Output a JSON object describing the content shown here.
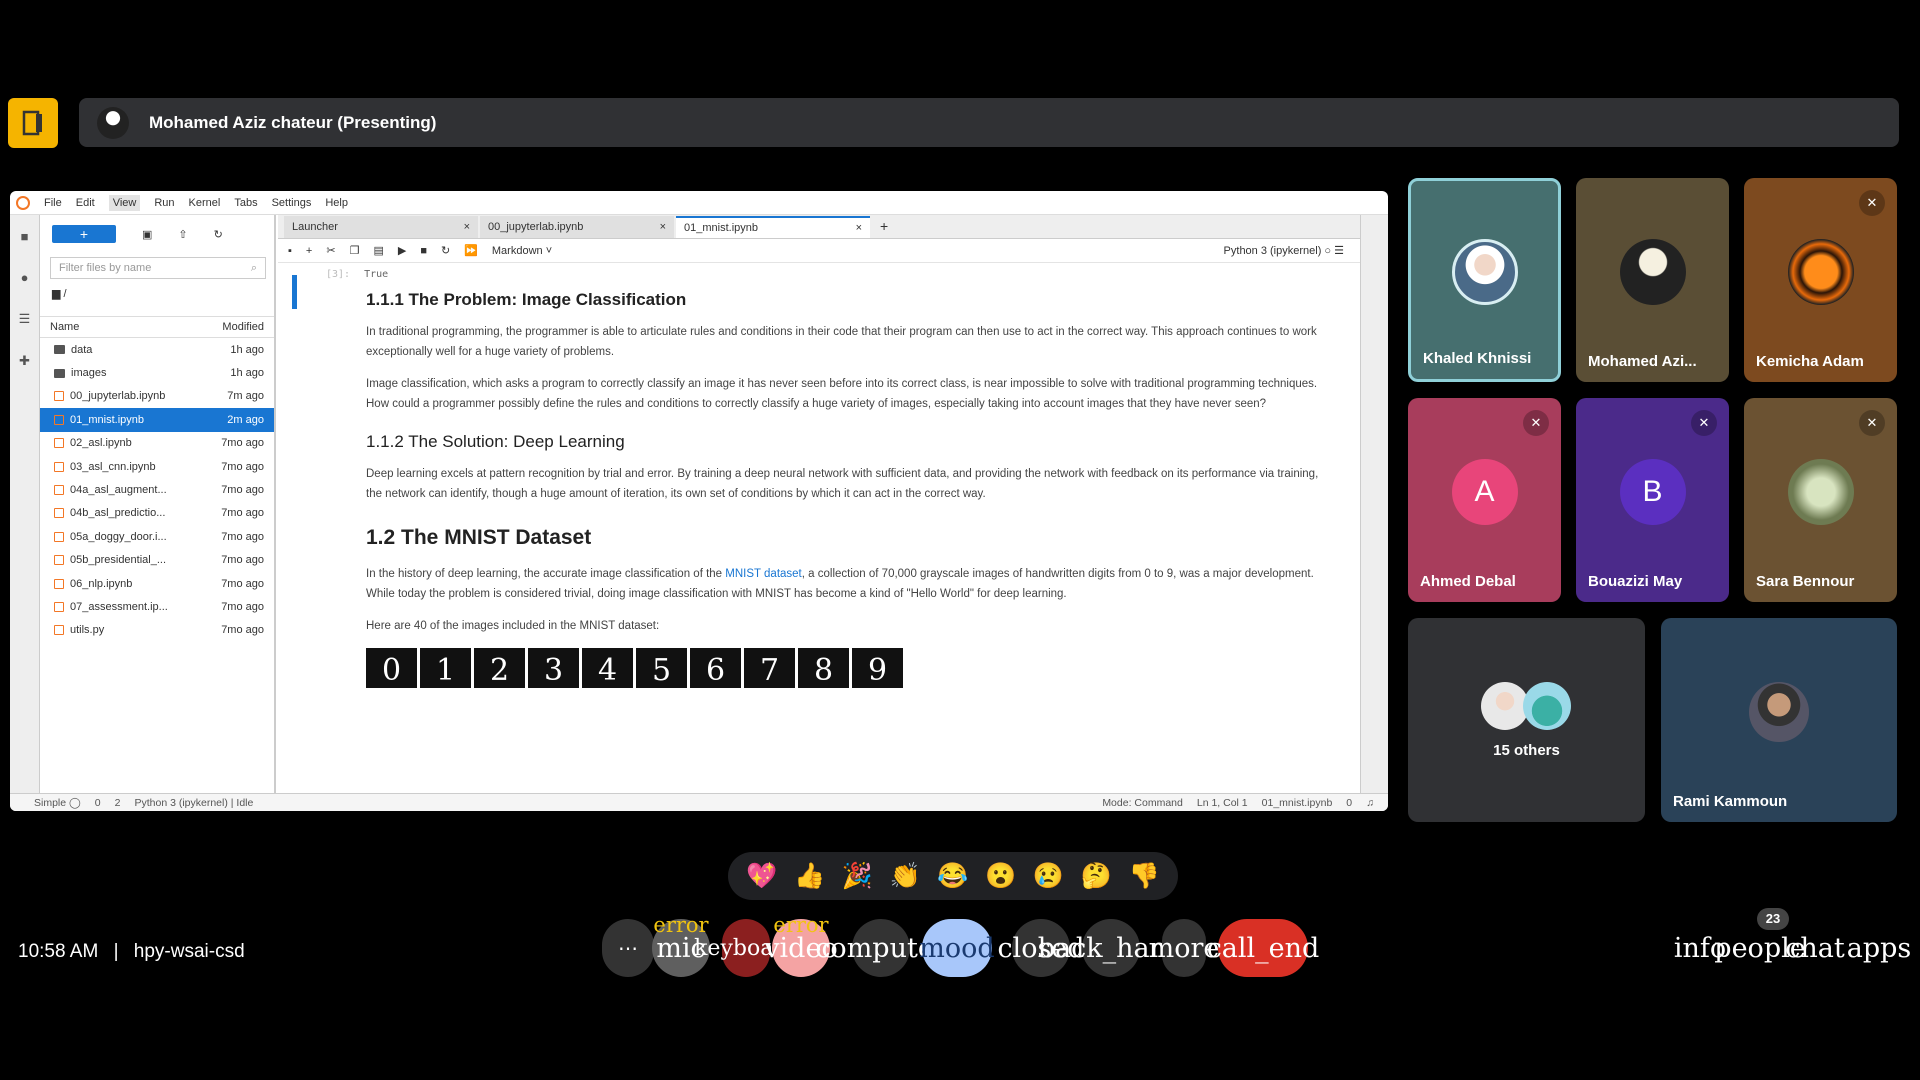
{
  "presenter": {
    "label": "Mohamed Aziz chateur (Presenting)"
  },
  "jupyter": {
    "menu": [
      "File",
      "Edit",
      "View",
      "Run",
      "Kernel",
      "Tabs",
      "Settings",
      "Help"
    ],
    "filter_placeholder": "Filter files by name",
    "crumb": "/",
    "col_name": "Name",
    "col_modified": "Modified",
    "files": [
      {
        "name": "data",
        "mod": "1h ago"
      },
      {
        "name": "images",
        "mod": "1h ago"
      },
      {
        "name": "00_jupyterlab.ipynb",
        "mod": "7m ago"
      },
      {
        "name": "01_mnist.ipynb",
        "mod": "2m ago"
      },
      {
        "name": "02_asl.ipynb",
        "mod": "7mo ago"
      },
      {
        "name": "03_asl_cnn.ipynb",
        "mod": "7mo ago"
      },
      {
        "name": "04a_asl_augment...",
        "mod": "7mo ago"
      },
      {
        "name": "04b_asl_predictio...",
        "mod": "7mo ago"
      },
      {
        "name": "05a_doggy_door.i...",
        "mod": "7mo ago"
      },
      {
        "name": "05b_presidential_...",
        "mod": "7mo ago"
      },
      {
        "name": "06_nlp.ipynb",
        "mod": "7mo ago"
      },
      {
        "name": "07_assessment.ip...",
        "mod": "7mo ago"
      },
      {
        "name": "utils.py",
        "mod": "7mo ago"
      }
    ],
    "tabs": [
      "Launcher",
      "00_jupyterlab.ipynb",
      "01_mnist.ipynb"
    ],
    "celltype": "Markdown",
    "kernel": "Python 3 (ipykernel)",
    "out_label": "[3]:",
    "out_text": "True",
    "h_problem": "1.1.1 The Problem: Image Classification",
    "p1": "In traditional programming, the programmer is able to articulate rules and conditions in their code that their program can then use to act in the correct way. This approach continues to work exceptionally well for a huge variety of problems.",
    "p2": "Image classification, which asks a program to correctly classify an image it has never seen before into its correct class, is near impossible to solve with traditional programming techniques. How could a programmer possibly define the rules and conditions to correctly classify a huge variety of images, especially taking into account images that they have never seen?",
    "h_solution": "1.1.2 The Solution: Deep Learning",
    "p3": "Deep learning excels at pattern recognition by trial and error. By training a deep neural network with sufficient data, and providing the network with feedback on its performance via training, the network can identify, though a huge amount of iteration, its own set of conditions by which it can act in the correct way.",
    "h_mnist": "1.2 The MNIST Dataset",
    "p4a": "In the history of deep learning, the accurate image classification of the ",
    "p4link": "MNIST dataset",
    "p4b": ", a collection of 70,000 grayscale images of handwritten digits from 0 to 9, was a major development. While today the problem is considered trivial, doing image classification with MNIST has become a kind of \"Hello World\" for deep learning.",
    "p5": "Here are 40 of the images included in the MNIST dataset:",
    "digits": [
      "0",
      "1",
      "2",
      "3",
      "4",
      "5",
      "6",
      "7",
      "8",
      "9"
    ],
    "status_simple": "Simple",
    "status_n1": "0",
    "status_n2": "2",
    "status_kernel": "Python 3 (ipykernel) | Idle",
    "status_mode": "Mode: Command",
    "status_pos": "Ln 1, Col 1",
    "status_file": "01_mnist.ipynb",
    "status_n3": "0"
  },
  "participants": {
    "khaled": "Khaled Khnissi",
    "mohamed": "Mohamed Azi...",
    "kemicha": "Kemicha Adam",
    "ahmed": "Ahmed Debal",
    "ahmed_initial": "A",
    "bouazizi": "Bouazizi May",
    "bouazizi_initial": "B",
    "sara": "Sara Bennour",
    "others": "15 others",
    "rami": "Rami Kammoun"
  },
  "reactions": [
    "💖",
    "👍",
    "🎉",
    "👏",
    "😂",
    "😮",
    "😢",
    "🤔",
    "👎"
  ],
  "bottom": {
    "time": "10:58 AM",
    "sep": "|",
    "meeting": "hpy-wsai-csd",
    "more_dots": "⋯",
    "mic": "mic",
    "mic_err": "error",
    "keyboard": "keyboard",
    "video": "video",
    "video_err": "error",
    "computer": "computer",
    "mood": "mood",
    "cc": "closed",
    "hand": "back_hand",
    "more": "more",
    "call_end": "call_end",
    "info": "info",
    "people": "people",
    "chat": "chat",
    "apps": "apps",
    "people_count": "23"
  }
}
